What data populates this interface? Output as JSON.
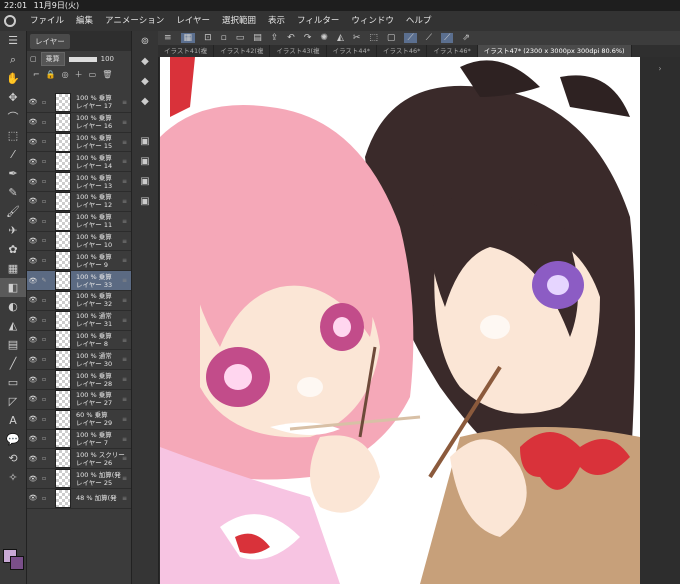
{
  "status": {
    "time": "22:01",
    "date": "11月9日(火)"
  },
  "menu": [
    "ファイル",
    "編集",
    "アニメーション",
    "レイヤー",
    "選択範囲",
    "表示",
    "フィルター",
    "ウィンドウ",
    "ヘルプ"
  ],
  "layer_panel": {
    "tab": "レイヤー",
    "blend_mode": "乗算",
    "opacity": "100",
    "layers": [
      {
        "top": "100 % 乗算",
        "name": "レイヤー 17",
        "selected": false
      },
      {
        "top": "100 % 乗算",
        "name": "レイヤー 16",
        "selected": false
      },
      {
        "top": "100 % 乗算",
        "name": "レイヤー 15",
        "selected": false
      },
      {
        "top": "100 % 乗算",
        "name": "レイヤー 14",
        "selected": false
      },
      {
        "top": "100 % 乗算",
        "name": "レイヤー 13",
        "selected": false
      },
      {
        "top": "100 % 乗算",
        "name": "レイヤー 12",
        "selected": false
      },
      {
        "top": "100 % 乗算",
        "name": "レイヤー 11",
        "selected": false
      },
      {
        "top": "100 % 乗算",
        "name": "レイヤー 10",
        "selected": false
      },
      {
        "top": "100 % 乗算",
        "name": "レイヤー 9",
        "selected": false
      },
      {
        "top": "100 % 乗算",
        "name": "レイヤー 33",
        "selected": true
      },
      {
        "top": "100 % 乗算",
        "name": "レイヤー 32",
        "selected": false
      },
      {
        "top": "100 % 通常",
        "name": "レイヤー 31",
        "selected": false
      },
      {
        "top": "100 % 乗算",
        "name": "レイヤー 8",
        "selected": false
      },
      {
        "top": "100 % 通常",
        "name": "レイヤー 30",
        "selected": false
      },
      {
        "top": "100 % 乗算",
        "name": "レイヤー 28",
        "selected": false
      },
      {
        "top": "100 % 乗算",
        "name": "レイヤー 27",
        "selected": false
      },
      {
        "top": "60 % 乗算",
        "name": "レイヤー 29",
        "selected": false
      },
      {
        "top": "100 % 乗算",
        "name": "レイヤー 7",
        "selected": false
      },
      {
        "top": "100 % スクリー",
        "name": "レイヤー 26",
        "selected": false
      },
      {
        "top": "100 % 加算(発",
        "name": "レイヤー 25",
        "selected": false
      },
      {
        "top": "48 % 加算(発",
        "name": "",
        "selected": false
      }
    ]
  },
  "document_tabs": [
    {
      "label": "イラスト41(複",
      "active": false
    },
    {
      "label": "イラスト42(複",
      "active": false
    },
    {
      "label": "イラスト43(複",
      "active": false
    },
    {
      "label": "イラスト44*",
      "active": false
    },
    {
      "label": "イラスト46*",
      "active": false
    },
    {
      "label": "イラスト46*",
      "active": false
    },
    {
      "label": "イラスト47* (2300 x 3000px 300dpi 80.6%)",
      "active": true
    }
  ],
  "colors": {
    "accent": "#5b6f8f",
    "pink_hair": "#f5a8b8",
    "dark_hair": "#3a2a2a",
    "ribbon": "#d9323a",
    "skin": "#fbe6d6"
  }
}
